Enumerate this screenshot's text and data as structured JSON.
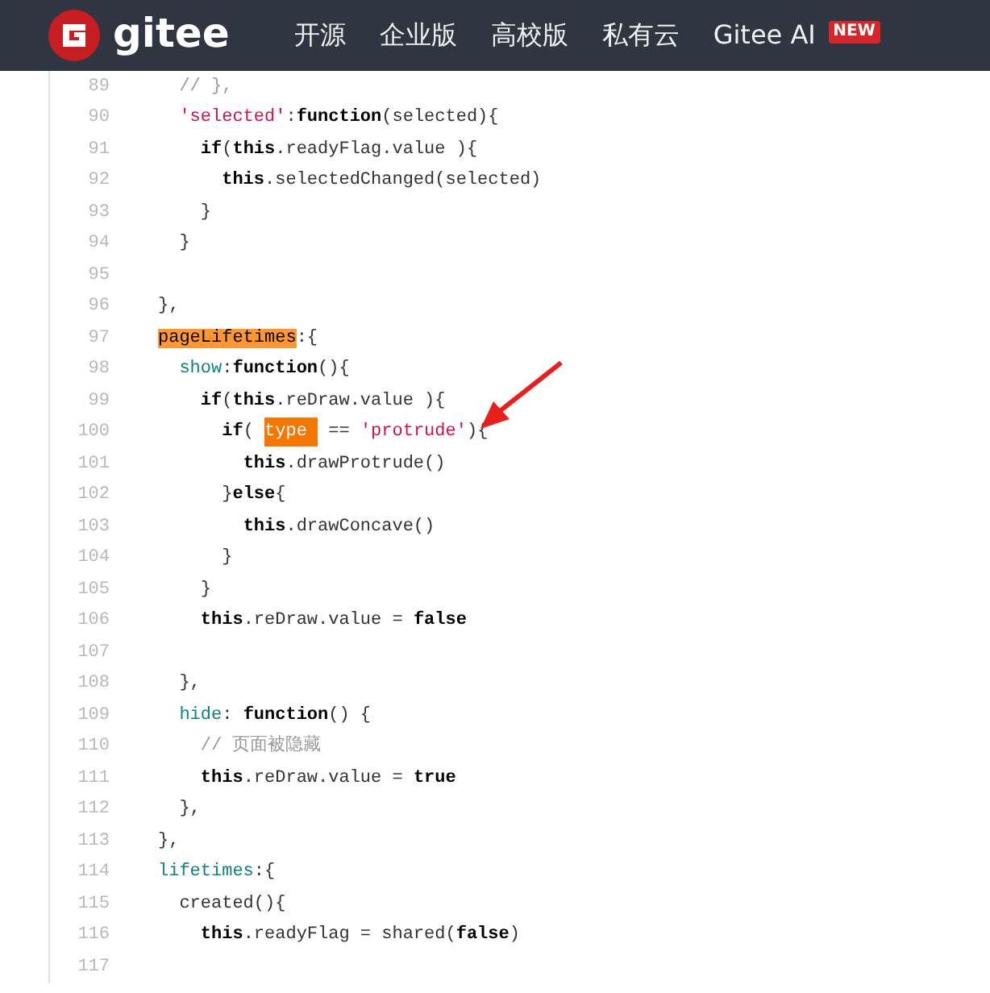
{
  "header": {
    "logo_text": "gitee",
    "nav": [
      {
        "label": "开源"
      },
      {
        "label": "企业版"
      },
      {
        "label": "高校版"
      },
      {
        "label": "私有云"
      },
      {
        "label": "Gitee AI",
        "badge": "NEW"
      }
    ]
  },
  "code": {
    "lines": [
      {
        "number": "89",
        "tokens": [
          {
            "kind": "comment",
            "text": "  // },"
          }
        ]
      },
      {
        "number": "90",
        "tokens": [
          {
            "kind": "str",
            "text": "  'selected'"
          },
          {
            "kind": "plain",
            "text": ":"
          },
          {
            "kind": "kw",
            "text": "function"
          },
          {
            "kind": "plain",
            "text": "(selected){"
          }
        ]
      },
      {
        "number": "91",
        "tokens": [
          {
            "kind": "kw",
            "text": "    if"
          },
          {
            "kind": "plain",
            "text": "("
          },
          {
            "kind": "kw",
            "text": "this"
          },
          {
            "kind": "plain",
            "text": ".readyFlag.value ){"
          }
        ]
      },
      {
        "number": "92",
        "tokens": [
          {
            "kind": "kw",
            "text": "      this"
          },
          {
            "kind": "plain",
            "text": ".selectedChanged(selected)"
          }
        ]
      },
      {
        "number": "93",
        "tokens": [
          {
            "kind": "plain",
            "text": "    }"
          }
        ]
      },
      {
        "number": "94",
        "tokens": [
          {
            "kind": "plain",
            "text": "  }"
          }
        ]
      },
      {
        "number": "95"
      },
      {
        "number": "96",
        "tokens": [
          {
            "kind": "plain",
            "text": "},"
          }
        ]
      },
      {
        "number": "97",
        "tokens": [
          {
            "kind": "match",
            "text": "pageLifetimes"
          },
          {
            "kind": "plain",
            "text": ":{"
          }
        ]
      },
      {
        "number": "98",
        "tokens": [
          {
            "kind": "prop",
            "text": "  show"
          },
          {
            "kind": "plain",
            "text": ":"
          },
          {
            "kind": "kw",
            "text": "function"
          },
          {
            "kind": "plain",
            "text": "(){"
          }
        ]
      },
      {
        "number": "99",
        "tokens": [
          {
            "kind": "kw",
            "text": "    if"
          },
          {
            "kind": "plain",
            "text": "("
          },
          {
            "kind": "kw",
            "text": "this"
          },
          {
            "kind": "plain",
            "text": ".reDraw.value ){"
          }
        ]
      },
      {
        "number": "100",
        "tokens": [
          {
            "kind": "kw",
            "text": "      if"
          },
          {
            "kind": "plain",
            "text": "( "
          },
          {
            "kind": "current",
            "text": "type "
          },
          {
            "kind": "plain",
            "text": " == "
          },
          {
            "kind": "str",
            "text": "'protrude'"
          },
          {
            "kind": "plain",
            "text": "){"
          }
        ]
      },
      {
        "number": "101",
        "tokens": [
          {
            "kind": "kw",
            "text": "        this"
          },
          {
            "kind": "plain",
            "text": ".drawProtrude()"
          }
        ]
      },
      {
        "number": "102",
        "tokens": [
          {
            "kind": "plain",
            "text": "      }"
          },
          {
            "kind": "kw",
            "text": "else"
          },
          {
            "kind": "plain",
            "text": "{"
          }
        ]
      },
      {
        "number": "103",
        "tokens": [
          {
            "kind": "kw",
            "text": "        this"
          },
          {
            "kind": "plain",
            "text": ".drawConcave()"
          }
        ]
      },
      {
        "number": "104",
        "tokens": [
          {
            "kind": "plain",
            "text": "      }"
          }
        ]
      },
      {
        "number": "105",
        "tokens": [
          {
            "kind": "plain",
            "text": "    }"
          }
        ]
      },
      {
        "number": "106",
        "tokens": [
          {
            "kind": "kw",
            "text": "    this"
          },
          {
            "kind": "plain",
            "text": ".reDraw.value = "
          },
          {
            "kind": "kw",
            "text": "false"
          }
        ]
      },
      {
        "number": "107"
      },
      {
        "number": "108",
        "tokens": [
          {
            "kind": "plain",
            "text": "  },"
          }
        ]
      },
      {
        "number": "109",
        "tokens": [
          {
            "kind": "prop",
            "text": "  hide"
          },
          {
            "kind": "plain",
            "text": ": "
          },
          {
            "kind": "kw",
            "text": "function"
          },
          {
            "kind": "plain",
            "text": "() {"
          }
        ]
      },
      {
        "number": "110",
        "tokens": [
          {
            "kind": "comment",
            "text": "    // 页面被隐藏"
          }
        ]
      },
      {
        "number": "111",
        "tokens": [
          {
            "kind": "kw",
            "text": "    this"
          },
          {
            "kind": "plain",
            "text": ".reDraw.value = "
          },
          {
            "kind": "kw",
            "text": "true"
          }
        ]
      },
      {
        "number": "112",
        "tokens": [
          {
            "kind": "plain",
            "text": "  },"
          }
        ]
      },
      {
        "number": "113",
        "tokens": [
          {
            "kind": "plain",
            "text": "},"
          }
        ]
      },
      {
        "number": "114",
        "tokens": [
          {
            "kind": "prop",
            "text": "lifetimes"
          },
          {
            "kind": "plain",
            "text": ":{"
          }
        ]
      },
      {
        "number": "115",
        "tokens": [
          {
            "kind": "plain",
            "text": "  created(){"
          }
        ]
      },
      {
        "number": "116",
        "tokens": [
          {
            "kind": "kw",
            "text": "    this"
          },
          {
            "kind": "plain",
            "text": ".readyFlag = shared("
          },
          {
            "kind": "kw",
            "text": "false"
          },
          {
            "kind": "plain",
            "text": ")"
          }
        ]
      },
      {
        "number": "117"
      }
    ]
  }
}
